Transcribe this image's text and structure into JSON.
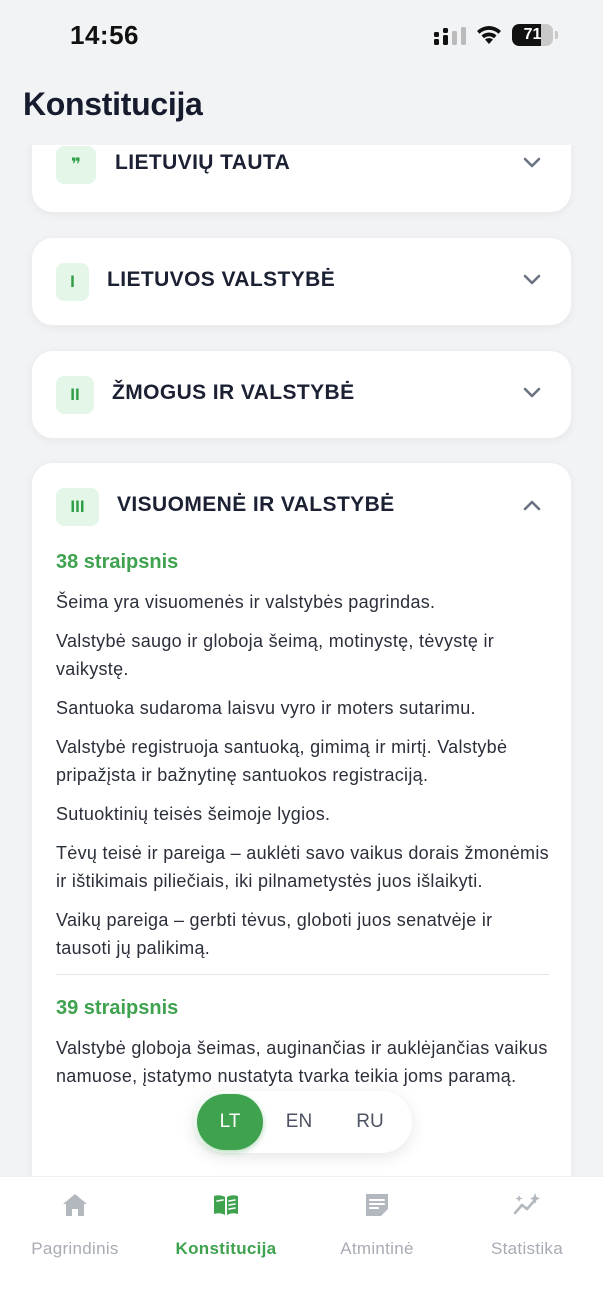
{
  "status_bar": {
    "time": "14:56",
    "battery": "71",
    "battery_level": 0.71
  },
  "header": {
    "title": "Konstitucija"
  },
  "sections": [
    {
      "badge": "❞",
      "title": "LIETUVIŲ TAUTA",
      "expanded": false
    },
    {
      "badge": "I",
      "title": "LIETUVOS VALSTYBĖ",
      "expanded": false
    },
    {
      "badge": "II",
      "title": "ŽMOGUS IR VALSTYBĖ",
      "expanded": false
    },
    {
      "badge": "III",
      "title": "VISUOMENĖ IR VALSTYBĖ",
      "expanded": true
    }
  ],
  "articles": [
    {
      "number": "38 straipsnis",
      "paragraphs": [
        "Šeima yra visuomenės ir valstybės pagrindas.",
        "Valstybė saugo ir globoja šeimą, motinystę, tėvystę ir vaikystę.",
        "Santuoka sudaroma laisvu vyro ir moters sutarimu.",
        "Valstybė registruoja santuoką, gimimą ir mirtį. Valstybė pripažįsta ir bažnytinę santuokos registraciją.",
        "Sutuoktinių teisės šeimoje lygios.",
        "Tėvų teisė ir pareiga – auklėti savo vaikus dorais žmonėmis ir ištikimais piliečiais, iki pilnametystės juos išlaikyti.",
        "Vaikų pareiga – gerbti tėvus, globoti juos senatvėje ir tausoti jų palikimą."
      ]
    },
    {
      "number": "39 straipsnis",
      "paragraphs": [
        "Valstybė globoja šeimas, auginančias ir auklėjančias vaikus namuose, įstatymo nustatyta tvarka teikia joms paramą."
      ]
    }
  ],
  "language_switcher": {
    "options": [
      "LT",
      "EN",
      "RU"
    ],
    "selected": "LT"
  },
  "tab_bar": {
    "tabs": [
      {
        "label": "Pagrindinis",
        "icon": "home-icon"
      },
      {
        "label": "Konstitucija",
        "icon": "open-book-icon"
      },
      {
        "label": "Atmintinė",
        "icon": "note-icon"
      },
      {
        "label": "Statistika",
        "icon": "sparkle-chart-icon"
      }
    ],
    "active": "Konstitucija"
  },
  "colors": {
    "accent": "#3fa24f",
    "badge_bg": "#e3f6e7",
    "inactive": "#a7abb3",
    "background": "#f2f3f5"
  }
}
